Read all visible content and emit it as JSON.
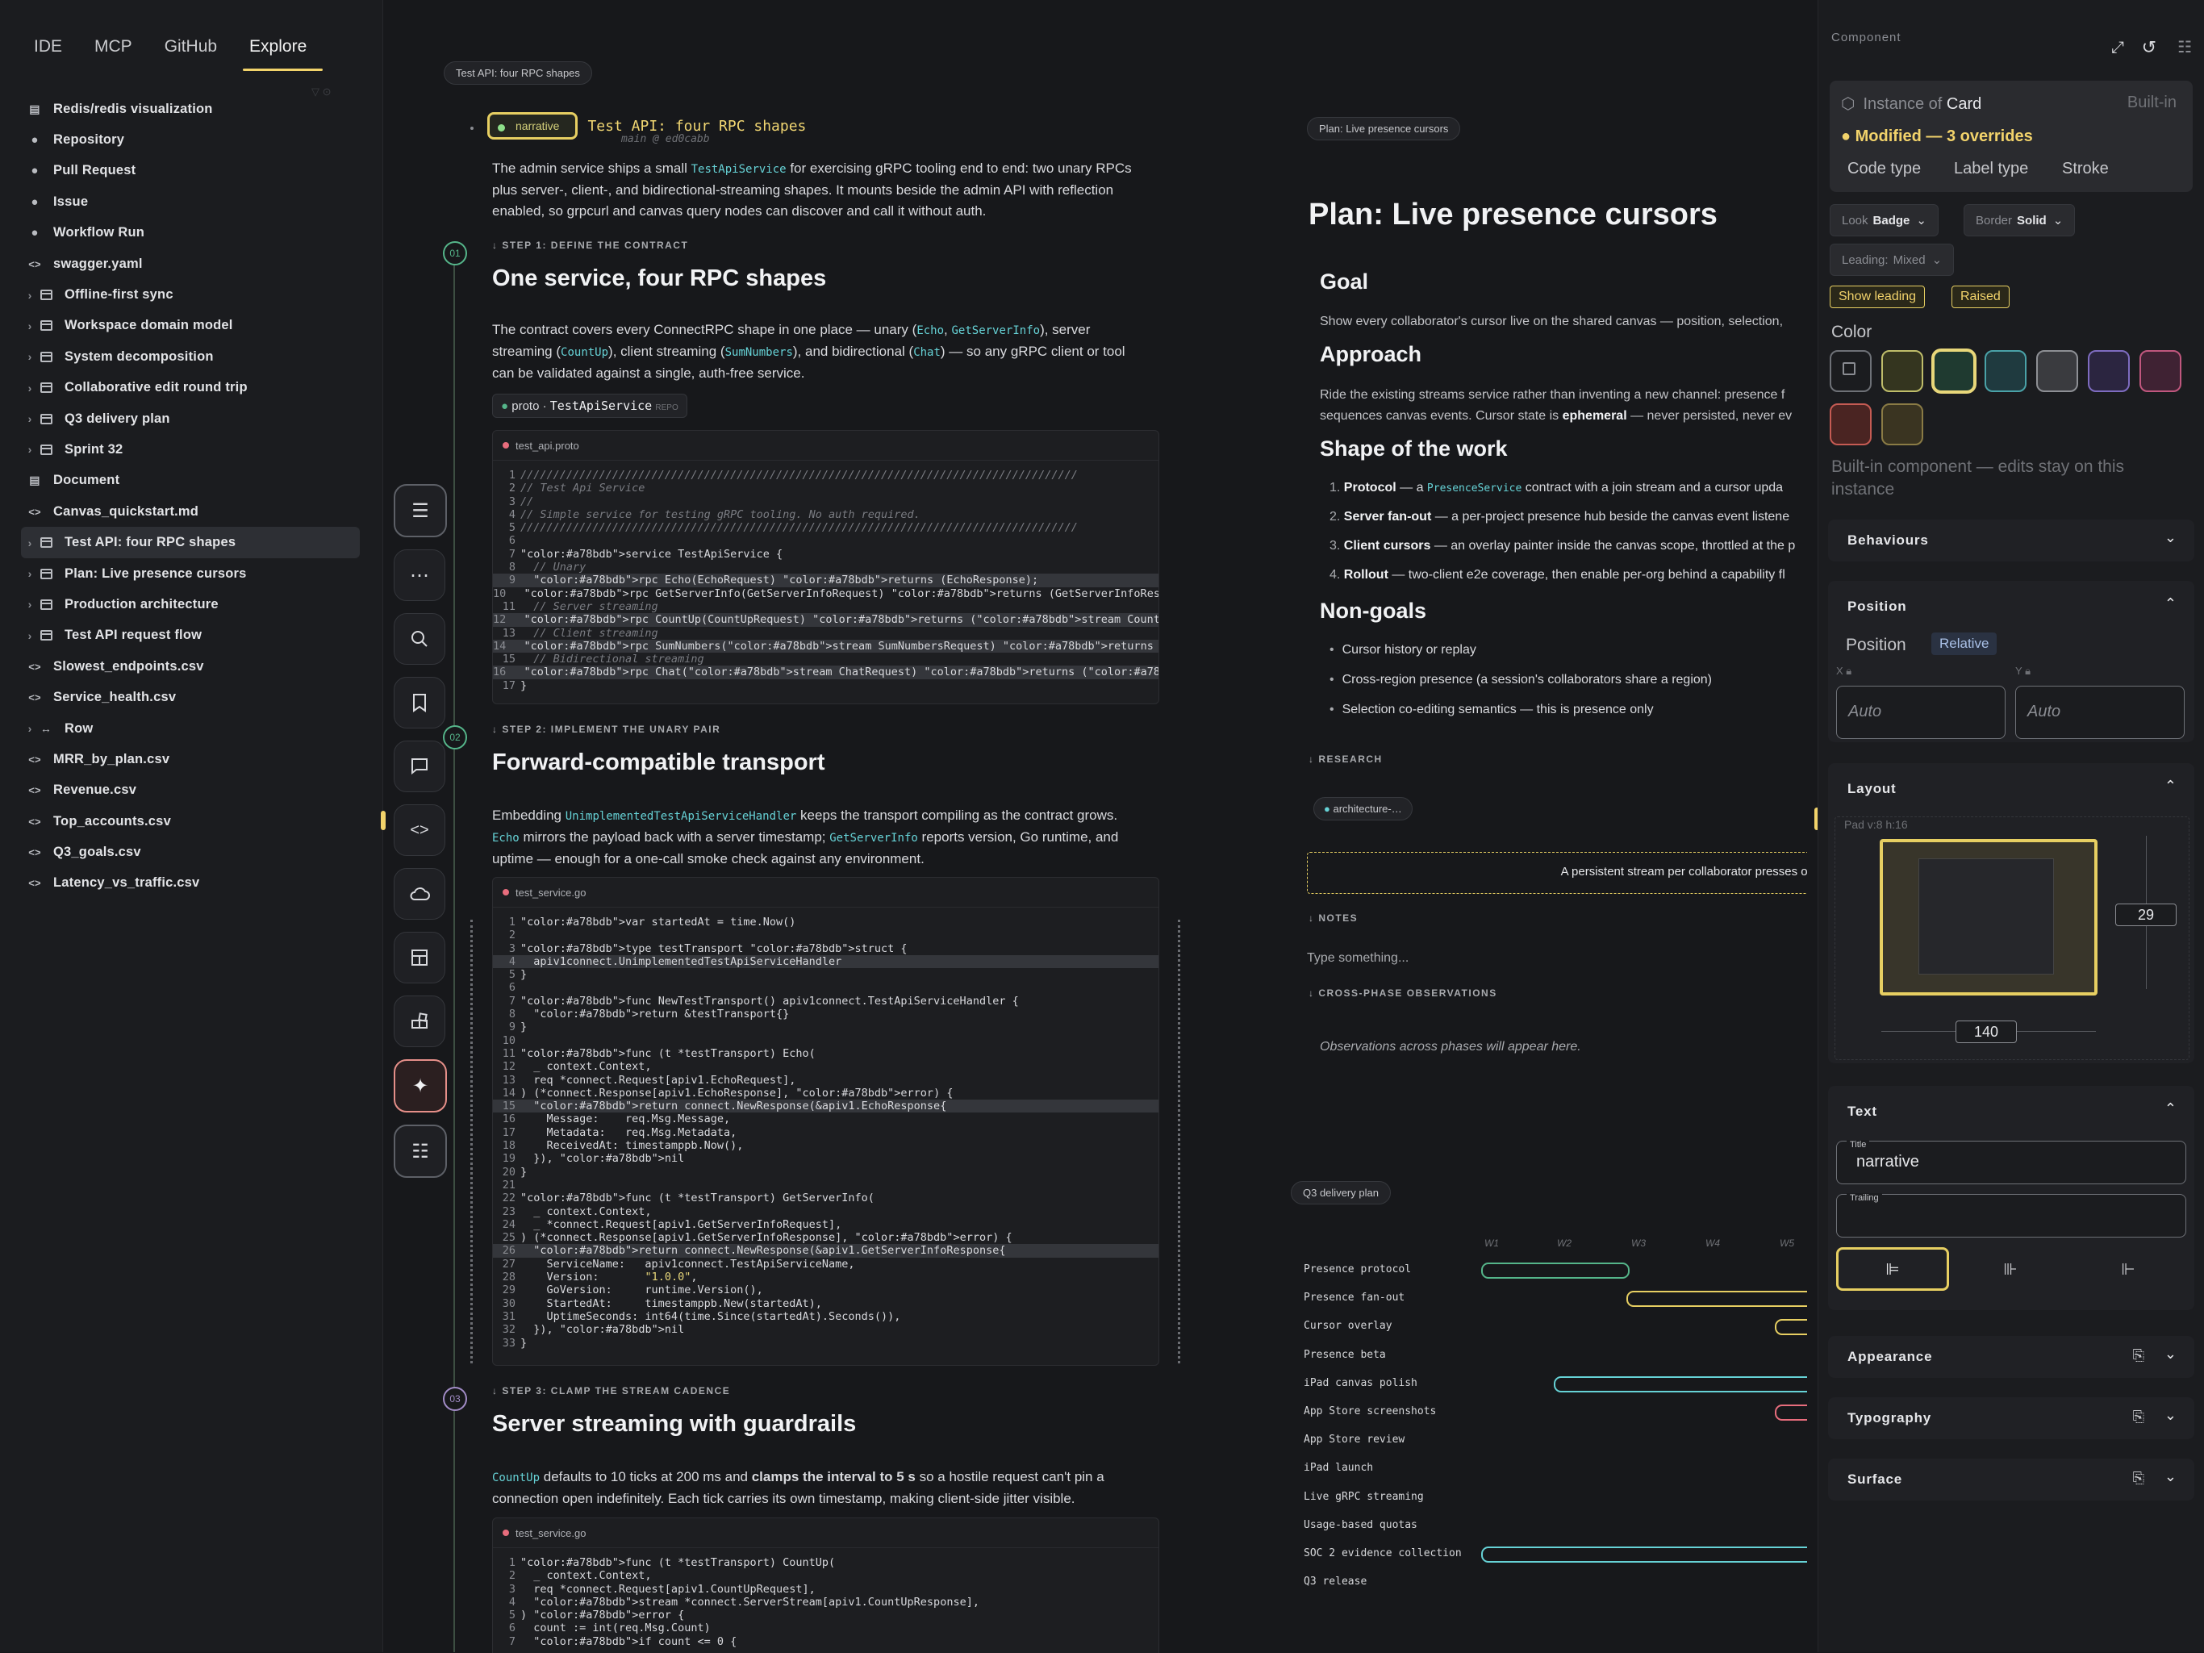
{
  "window": {
    "controls": [
      "close",
      "minimize",
      "maximize"
    ],
    "colors": [
      "#ee5f57",
      "#f5bd2f",
      "#28c840"
    ]
  },
  "sidebar": {
    "tabs": [
      {
        "label": "IDE",
        "active": false
      },
      {
        "label": "MCP",
        "active": false
      },
      {
        "label": "GitHub",
        "active": false
      },
      {
        "label": "Explore",
        "active": true
      }
    ],
    "items": [
      {
        "label": "Redis/redis visualization",
        "icon": "doc-icon",
        "chevron": false
      },
      {
        "label": "Repository",
        "icon": "github-icon",
        "chevron": false
      },
      {
        "label": "Pull Request",
        "icon": "github-icon",
        "chevron": false
      },
      {
        "label": "Issue",
        "icon": "github-icon",
        "chevron": false
      },
      {
        "label": "Workflow Run",
        "icon": "github-icon",
        "chevron": false
      },
      {
        "label": "swagger.yaml",
        "icon": "code-icon",
        "chevron": false
      },
      {
        "label": "Offline-first sync",
        "icon": "frame-icon",
        "chevron": true
      },
      {
        "label": "Workspace domain model",
        "icon": "frame-icon",
        "chevron": true
      },
      {
        "label": "System decomposition",
        "icon": "frame-icon",
        "chevron": true
      },
      {
        "label": "Collaborative edit round trip",
        "icon": "frame-icon",
        "chevron": true
      },
      {
        "label": "Q3 delivery plan",
        "icon": "frame-icon",
        "chevron": true
      },
      {
        "label": "Sprint 32",
        "icon": "frame-icon",
        "chevron": true
      },
      {
        "label": "Document",
        "icon": "doc-icon",
        "chevron": false
      },
      {
        "label": "Canvas_quickstart.md",
        "icon": "code-icon",
        "chevron": false
      },
      {
        "label": "Test API: four RPC shapes",
        "icon": "frame-icon",
        "chevron": true,
        "selected": true
      },
      {
        "label": "Plan: Live presence cursors",
        "icon": "frame-icon",
        "chevron": true
      },
      {
        "label": "Production architecture",
        "icon": "frame-icon",
        "chevron": true
      },
      {
        "label": "Test API request flow",
        "icon": "frame-icon",
        "chevron": true
      },
      {
        "label": "Slowest_endpoints.csv",
        "icon": "code-icon",
        "chevron": false
      },
      {
        "label": "Service_health.csv",
        "icon": "code-icon",
        "chevron": false
      },
      {
        "label": "Row",
        "icon": "row-icon",
        "chevron": true
      },
      {
        "label": "MRR_by_plan.csv",
        "icon": "code-icon",
        "chevron": false
      },
      {
        "label": "Revenue.csv",
        "icon": "code-icon",
        "chevron": false
      },
      {
        "label": "Top_accounts.csv",
        "icon": "code-icon",
        "chevron": false
      },
      {
        "label": "Q3_goals.csv",
        "icon": "code-icon",
        "chevron": false
      },
      {
        "label": "Latency_vs_traffic.csv",
        "icon": "code-icon",
        "chevron": false
      }
    ]
  },
  "toolbar": {
    "icons": [
      "outline-icon",
      "more-icon",
      "search-icon",
      "bookmark-icon",
      "comment-icon",
      "code-icon",
      "cloud-icon",
      "layout-icon",
      "components-icon",
      "sparkle-icon",
      "sliders-icon"
    ]
  },
  "doc": {
    "frame_chip": "Test API: four RPC shapes",
    "badge": "narrative",
    "heading": "Test API: four RPC shapes",
    "branch": "main @ ed0cabb",
    "intro_lines": [
      "The admin service ships a small TestApiService for exercising gRPC tooling end to end: two unary RPCs",
      "plus server-, client-, and bidirectional-streaming shapes. It mounts beside the admin API with reflection",
      "enabled, so grpcurl and canvas query nodes can discover and call it without auth."
    ],
    "steps": [
      {
        "num": "01",
        "label": "STEP 1: DEFINE THE CONTRACT",
        "title": "One service, four RPC shapes",
        "lines": [
          "The contract covers every ConnectRPC shape in one place — unary (Echo, GetServerInfo), server",
          "streaming (CountUp), client streaming (SumNumbers), and bidirectional (Chat) — so any gRPC client or tool",
          "can be validated against a single, auth-free service."
        ]
      },
      {
        "num": "02",
        "label": "STEP 2: IMPLEMENT THE UNARY PAIR",
        "title": "Forward-compatible transport",
        "lines": [
          "Embedding UnimplementedTestApiServiceHandler keeps the transport compiling as the contract grows.",
          "Echo mirrors the payload back with a server timestamp; GetServerInfo reports version, Go runtime, and",
          "uptime — enough for a one-call smoke check against any environment."
        ]
      },
      {
        "num": "03",
        "label": "STEP 3: CLAMP THE STREAM CADENCE",
        "title": "Server streaming with guardrails",
        "lines": [
          "CountUp defaults to 10 ticks at 200 ms and clamps the interval to 5 s so a hostile request can't pin a",
          "connection open indefinitely. Each tick carries its own timestamp, making client-side jitter visible."
        ]
      }
    ],
    "proto_pill": {
      "kind": "proto",
      "name": "TestApiService",
      "tag": "REPO"
    },
    "code1": {
      "file": "test_api.proto",
      "lines": [
        "/////////////////////////////////////////////////////////////////////////////////////",
        "// Test Api Service",
        "//",
        "// Simple service for testing gRPC tooling. No auth required.",
        "/////////////////////////////////////////////////////////////////////////////////////",
        "",
        "service TestApiService {",
        "  // Unary",
        "  rpc Echo(EchoRequest) returns (EchoResponse);",
        "  rpc GetServerInfo(GetServerInfoRequest) returns (GetServerInfoResponse);",
        "  // Server streaming",
        "  rpc CountUp(CountUpRequest) returns (stream CountUpResponse);",
        "  // Client streaming",
        "  rpc SumNumbers(stream SumNumbersRequest) returns (SumNumbersResponse);",
        "  // Bidirectional streaming",
        "  rpc Chat(stream ChatRequest) returns (stream ChatResponse);",
        "}"
      ],
      "highlight": [
        9,
        12,
        14,
        16
      ]
    },
    "code2": {
      "file": "test_service.go",
      "lines": [
        "var startedAt = time.Now()",
        "",
        "type testTransport struct {",
        "  apiv1connect.UnimplementedTestApiServiceHandler",
        "}",
        "",
        "func NewTestTransport() apiv1connect.TestApiServiceHandler {",
        "  return &testTransport{}",
        "}",
        "",
        "func (t *testTransport) Echo(",
        "  _ context.Context,",
        "  req *connect.Request[apiv1.EchoRequest],",
        ") (*connect.Response[apiv1.EchoResponse], error) {",
        "  return connect.NewResponse(&apiv1.EchoResponse{",
        "    Message:    req.Msg.Message,",
        "    Metadata:   req.Msg.Metadata,",
        "    ReceivedAt: timestamppb.Now(),",
        "  }), nil",
        "}",
        "",
        "func (t *testTransport) GetServerInfo(",
        "  _ context.Context,",
        "  _ *connect.Request[apiv1.GetServerInfoRequest],",
        ") (*connect.Response[apiv1.GetServerInfoResponse], error) {",
        "  return connect.NewResponse(&apiv1.GetServerInfoResponse{",
        "    ServiceName:   apiv1connect.TestApiServiceName,",
        "    Version:       \"1.0.0\",",
        "    GoVersion:     runtime.Version(),",
        "    StartedAt:     timestamppb.New(startedAt),",
        "    UptimeSeconds: int64(time.Since(startedAt).Seconds()),",
        "  }), nil",
        "}"
      ],
      "highlight": [
        4,
        15,
        26
      ]
    },
    "code3": {
      "file": "test_service.go",
      "lines": [
        "func (t *testTransport) CountUp(",
        "  _ context.Context,",
        "  req *connect.Request[apiv1.CountUpRequest],",
        "  stream *connect.ServerStream[apiv1.CountUpResponse],",
        ") error {",
        "  count := int(req.Msg.Count)",
        "  if count <= 0 {"
      ],
      "highlight": []
    }
  },
  "plan": {
    "chip": "Plan: Live presence cursors",
    "title": "Plan: Live presence cursors",
    "goal_h": "Goal",
    "goal": "Show every collaborator's cursor live on the shared canvas — position, selection,",
    "approach_h": "Approach",
    "approach1": "Ride the existing streams service rather than inventing a new channel: presence f",
    "approach2_pre": "sequences canvas events. Cursor state is ",
    "approach2_bold": "ephemeral",
    "approach2_post": " — never persisted, never ev",
    "shape_h": "Shape of the work",
    "shape": [
      {
        "n": "1.",
        "b": "Protocol",
        "t": " — a ",
        "c": "PresenceService",
        "r": " contract with a join stream and a cursor upda"
      },
      {
        "n": "2.",
        "b": "Server fan-out",
        "t": " — a per-project presence hub beside the canvas event listene",
        "c": "",
        "r": ""
      },
      {
        "n": "3.",
        "b": "Client cursors",
        "t": " — an overlay painter inside the canvas scope, throttled at the p",
        "c": "",
        "r": ""
      },
      {
        "n": "4.",
        "b": "Rollout",
        "t": " — two-client e2e coverage, then enable per-org behind a capability fl",
        "c": "",
        "r": ""
      }
    ],
    "nongoals_h": "Non-goals",
    "nongoals": [
      "Cursor history or replay",
      "Cross-region presence (a session's collaborators share a region)",
      "Selection co-editing semantics — this is presence only"
    ],
    "research": "RESEARCH",
    "research_chip": "architecture-…",
    "callout": "A persistent stream per collaborator presses on",
    "notes": "NOTES",
    "notes_placeholder": "Type something...",
    "cross": "CROSS-PHASE OBSERVATIONS",
    "cross_text": "Observations across phases will appear here.",
    "gantt_chip": "Q3 delivery plan",
    "weeks": [
      "W1",
      "W2",
      "W3",
      "W4",
      "W5"
    ],
    "rows": [
      "Presence protocol",
      "Presence fan-out",
      "Cursor overlay",
      "Presence beta",
      "iPad canvas polish",
      "App Store screenshots",
      "App Store review",
      "iPad launch",
      "Live gRPC streaming",
      "Usage-based quotas",
      "SOC 2 evidence collection",
      "Q3 release"
    ]
  },
  "panel": {
    "title": "Component",
    "instance_of": "Instance of",
    "instance_name": "Card",
    "builtin": "Built-in",
    "modified": "Modified — 3 overrides",
    "overrides": [
      "Code type",
      "Label type",
      "Stroke"
    ],
    "look": {
      "label": "Look",
      "value": "Badge"
    },
    "border": {
      "label": "Border",
      "value": "Solid"
    },
    "leading": {
      "label": "Leading:",
      "value": "Mixed"
    },
    "toggles": [
      "Show leading",
      "Raised"
    ],
    "color_label": "Color",
    "swatches": [
      "#1b1c1f",
      "#34351f",
      "#1f3a30",
      "#1f3a3f",
      "#3a3b3f",
      "#2b2540",
      "#3f2233",
      "#4a2422",
      "#3a3421"
    ],
    "swatch_borders": [
      "#6e7177",
      "#bfbd6a",
      "#e8d77a",
      "#4aa2a8",
      "#8d8f94",
      "#7e6cc0",
      "#c0577e",
      "#c55b53",
      "#8a7b45"
    ],
    "builtin_note": "Built-in component — edits stay on this instance",
    "behaviours": "Behaviours",
    "position": {
      "title": "Position",
      "label": "Position",
      "mode": "Relative",
      "x_label": "X",
      "y_label": "Y",
      "x_val": "Auto",
      "y_val": "Auto"
    },
    "layout": {
      "title": "Layout",
      "pad": "Pad v:8 h:16",
      "height": "29",
      "width": "140"
    },
    "text": {
      "title": "Text",
      "title_label": "Title",
      "title_val": "narrative",
      "trailing_label": "Trailing",
      "trailing_val": ""
    },
    "appearance": "Appearance",
    "typography": "Typography",
    "surface": "Surface",
    "accent": "#f2d36b"
  }
}
